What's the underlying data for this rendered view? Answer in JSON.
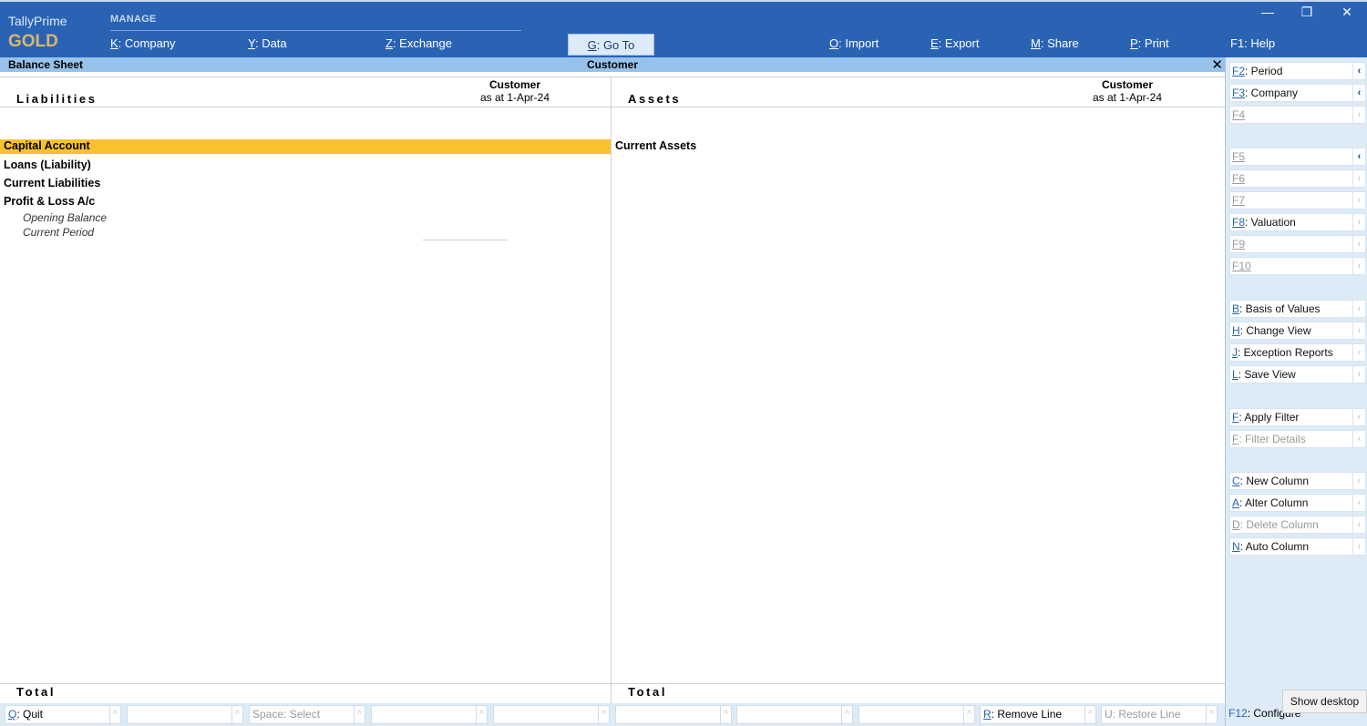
{
  "brand": {
    "line1": "TallyPrime",
    "line2": "GOLD"
  },
  "menu": {
    "section": "MANAGE",
    "items": [
      {
        "key": "K",
        "label": ": Company"
      },
      {
        "key": "Y",
        "label": ": Data"
      },
      {
        "key": "Z",
        "label": ": Exchange"
      },
      {
        "key": "G",
        "label": ": Go To"
      },
      {
        "key": "O",
        "label": ": Import"
      },
      {
        "key": "E",
        "label": ": Export"
      },
      {
        "key": "M",
        "label": ": Share"
      },
      {
        "key": "P",
        "label": ": Print"
      },
      {
        "key": "F1",
        "label": ": Help"
      }
    ]
  },
  "window_controls": {
    "minimize": "—",
    "restore": "❐",
    "close": "✕"
  },
  "report": {
    "title": "Balance Sheet",
    "company": "Customer",
    "close": "✕",
    "left_header": "Liabilities",
    "right_header": "Assets",
    "column_caption": "Customer",
    "column_date": "as at 1-Apr-24",
    "liabilities": [
      "Capital Account",
      "Loans (Liability)",
      "Current Liabilities",
      "Profit & Loss A/c"
    ],
    "pl_sub": [
      "Opening Balance",
      "Current Period"
    ],
    "assets": [
      "Current Assets"
    ],
    "total_label": "Total"
  },
  "sidebar": [
    {
      "key": "F2",
      "label": ": Period",
      "disabled": false
    },
    {
      "key": "F3",
      "label": ": Company",
      "disabled": false
    },
    {
      "key": "F4",
      "label": "",
      "disabled": true
    },
    {
      "key": "F5",
      "label": "",
      "disabled": true
    },
    {
      "key": "F6",
      "label": "",
      "disabled": true
    },
    {
      "key": "F7",
      "label": "",
      "disabled": true
    },
    {
      "key": "F8",
      "label": ": Valuation",
      "disabled": false
    },
    {
      "key": "F9",
      "label": "",
      "disabled": true
    },
    {
      "key": "F10",
      "label": "",
      "disabled": true
    },
    {
      "key": "B",
      "label": ": Basis of Values",
      "disabled": false
    },
    {
      "key": "H",
      "label": ": Change View",
      "disabled": false
    },
    {
      "key": "J",
      "label": ": Exception Reports",
      "disabled": false
    },
    {
      "key": "L",
      "label": ": Save View",
      "disabled": false
    },
    {
      "key": "F",
      "label": ": Apply Filter",
      "disabled": false
    },
    {
      "key": "F",
      "label": ": Filter Details",
      "disabled": true
    },
    {
      "key": "C",
      "label": ": New Column",
      "disabled": false
    },
    {
      "key": "A",
      "label": ": Alter Column",
      "disabled": false
    },
    {
      "key": "D",
      "label": ": Delete Column",
      "disabled": true
    },
    {
      "key": "N",
      "label": ": Auto Column",
      "disabled": false
    }
  ],
  "bottom": {
    "quit": {
      "key": "Q",
      "label": ": Quit"
    },
    "select": {
      "key": "Space",
      "label": ": Select"
    },
    "remove": {
      "key": "R",
      "label": ": Remove Line"
    },
    "restore": {
      "key": "U",
      "label": ": Restore Line"
    },
    "configure": {
      "key": "F12",
      "label": ": Configure"
    },
    "show_desktop": "Show desktop"
  }
}
